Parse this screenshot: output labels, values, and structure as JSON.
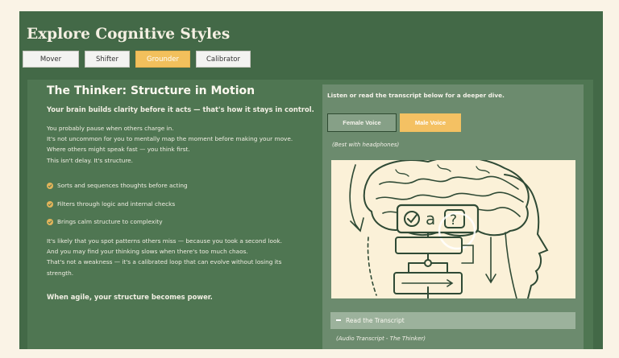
{
  "page": {
    "title": "Explore Cognitive Styles"
  },
  "tabs": [
    {
      "label": "Mover"
    },
    {
      "label": "Shifter"
    },
    {
      "label": "Grounder",
      "active": true
    },
    {
      "label": "Calibrator"
    }
  ],
  "main": {
    "heading": "The Thinker: Structure in Motion",
    "subheading": "Your brain builds clarity before it acts — that's how it stays in control.",
    "intro_lines": [
      "You probably pause when others charge in.",
      "It's not uncommon for you to mentally map the moment before making your move.",
      "Where others might speak fast — you think first.",
      "This isn't delay. It's structure."
    ],
    "bullets": [
      "Sorts and sequences thoughts before acting",
      "Filters through logic and internal checks",
      "Brings calm structure to complexity"
    ],
    "outro_lines": [
      "It's likely that you spot patterns others miss — because you took a second look.",
      "And you may find your thinking slows when there's too much chaos.",
      "That's not a weakness — it's a calibrated loop that can evolve without losing its strength."
    ],
    "closing": "When agile, your structure becomes power."
  },
  "audio": {
    "intro": "Listen or read the transcript below for a deeper dive.",
    "female_voice_label": "Female Voice",
    "male_voice_label": "Male Voice",
    "headphones_note": "(Best with headphones)",
    "illustration_glyph": "a",
    "illustration_question": "?",
    "transcript_toggle_label": "Read the Transcript",
    "transcript_label": "(Audio Transcript - The Thinker)"
  },
  "colors": {
    "frame_bg": "#436947",
    "content_bg": "#4f7652",
    "panel_bg": "#6c8b6e",
    "accent": "#f4c163",
    "page_bg": "#faf3e6",
    "illustration_bg": "#fbf1d8",
    "ink": "#2f4a35"
  },
  "icons": {
    "bullet": "check-circle-icon",
    "transcript_toggle": "minus-icon"
  }
}
